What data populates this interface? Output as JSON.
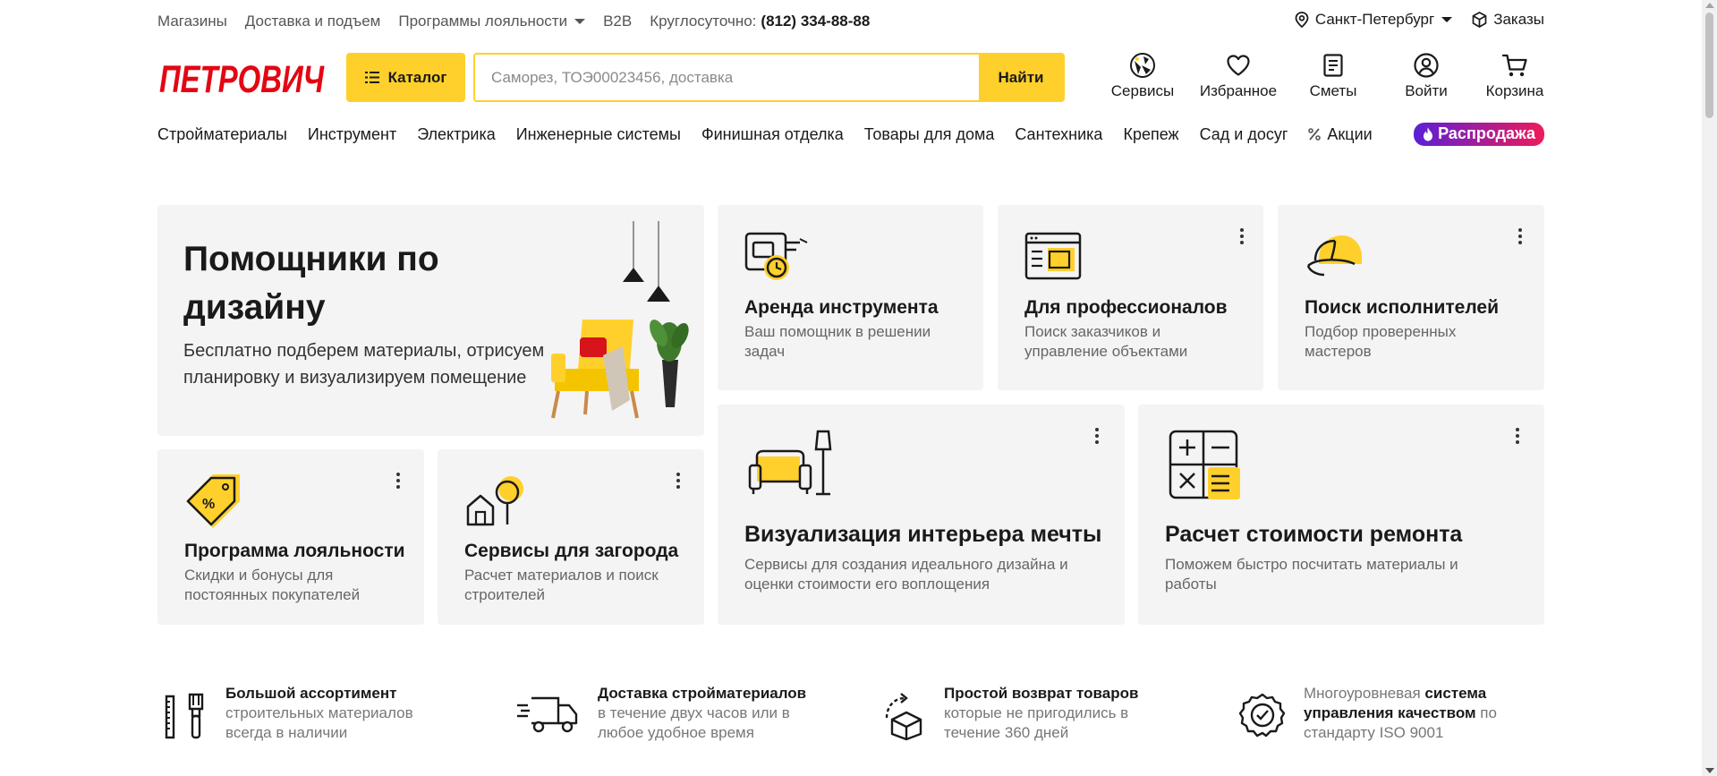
{
  "topbar": {
    "links": [
      "Магазины",
      "Доставка и подъем",
      "Программы лояльности",
      "B2B"
    ],
    "phone_label": "Круглосуточно:",
    "phone": "(812) 334-88-88",
    "city": "Санкт-Петербург",
    "orders": "Заказы"
  },
  "header": {
    "logo_text": "ПЕТРОВИЧ",
    "catalog_label": "Каталог",
    "search_placeholder": "Саморез, ТОЭ00023456, доставка",
    "search_button": "Найти",
    "icons": [
      {
        "label": "Сервисы",
        "icon": "services-icon"
      },
      {
        "label": "Избранное",
        "icon": "heart-icon"
      },
      {
        "label": "Сметы",
        "icon": "document-icon"
      },
      {
        "label": "Войти",
        "icon": "user-icon"
      },
      {
        "label": "Корзина",
        "icon": "cart-icon"
      }
    ]
  },
  "nav": {
    "items": [
      "Стройматериалы",
      "Инструмент",
      "Электрика",
      "Инженерные системы",
      "Финишная отделка",
      "Товары для дома",
      "Сантехника",
      "Крепеж",
      "Сад и досуг",
      "Акции"
    ],
    "sale_label": "Распродажа"
  },
  "hero": {
    "title": "Помощники по дизайну",
    "description": "Бесплатно подберем материалы, отрисуем планировку и визуализируем помещение"
  },
  "cards": {
    "rent": {
      "title": "Аренда инструмента",
      "desc": "Ваш помощник в решении задач"
    },
    "pro": {
      "title": "Для профессионалов",
      "desc": "Поиск заказчиков и управление объектами"
    },
    "contractors": {
      "title": "Поиск исполнителей",
      "desc": "Подбор проверенных мастеров"
    },
    "loyalty": {
      "title": "Программа лояльности",
      "desc": "Скидки и бонусы для постоянных покупателей"
    },
    "country": {
      "title": "Сервисы для загорода",
      "desc": "Расчет материалов и поиск строителей"
    },
    "visual": {
      "title": "Визуализация интерьера мечты",
      "desc": "Сервисы для создания идеального дизайна и оценки стоимости его воплощения"
    },
    "calc": {
      "title": "Расчет стоимости ремонта",
      "desc": "Поможем быстро посчитать материалы и работы"
    }
  },
  "features": [
    {
      "bold": "Большой ассортимент",
      "rest": "строительных материалов всегда в наличии"
    },
    {
      "bold": "Доставка стройматериалов",
      "rest": "в течение двух часов или в любое удобное время"
    },
    {
      "bold": "Простой возврат товаров",
      "rest": "которые не пригодились в течение 360 дней"
    },
    {
      "pre": "Многоуровневая",
      "bold": "система управления качеством",
      "post": "по стандарту ISO 9001"
    }
  ],
  "colors": {
    "brand_yellow": "#ffd02b",
    "brand_red": "#e30613",
    "card_bg": "#f4f4f5"
  }
}
